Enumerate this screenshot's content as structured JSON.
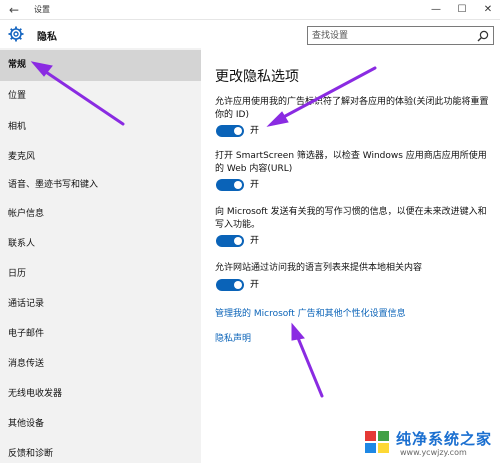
{
  "window": {
    "title": "设置",
    "back_icon": "back-arrow-icon",
    "controls": [
      "minimize-icon",
      "maximize-icon",
      "close-icon"
    ]
  },
  "header": {
    "title": "隐私",
    "icon": "gear-icon"
  },
  "search": {
    "placeholder": "查找设置",
    "icon": "search-icon"
  },
  "sidebar": {
    "items": [
      {
        "label": "常规",
        "active": true
      },
      {
        "label": "位置"
      },
      {
        "label": "相机"
      },
      {
        "label": "麦克风"
      },
      {
        "label": "语音、墨迹书写和键入"
      },
      {
        "label": "帐户信息"
      },
      {
        "label": "联系人"
      },
      {
        "label": "日历"
      },
      {
        "label": "通话记录"
      },
      {
        "label": "电子邮件"
      },
      {
        "label": "消息传送"
      },
      {
        "label": "无线电收发器"
      },
      {
        "label": "其他设备"
      },
      {
        "label": "反馈和诊断"
      }
    ]
  },
  "main": {
    "title": "更改隐私选项",
    "options": [
      {
        "description": "允许应用使用我的广告标识符了解对各应用的体验(关闭此功能将重置你的 ID)",
        "state_label": "开",
        "on": true
      },
      {
        "description": "打开 SmartScreen 筛选器，以检查 Windows 应用商店应用所使用的 Web 内容(URL)",
        "state_label": "开",
        "on": true
      },
      {
        "description": "向 Microsoft 发送有关我的写作习惯的信息，以便在未来改进键入和写入功能。",
        "state_label": "开",
        "on": true
      },
      {
        "description": "允许网站通过访问我的语言列表来提供本地相关内容",
        "state_label": "开",
        "on": true
      }
    ],
    "links": {
      "manage_ads": "管理我的 Microsoft 广告和其他个性化设置信息",
      "privacy_statement": "隐私声明"
    }
  },
  "watermark": {
    "text": "纯净系统之家",
    "url": "www.ycwjzy.com"
  },
  "colors": {
    "accent": "#0a63b8",
    "annotation_arrow": "#8a2be2",
    "sidebar_bg": "#f2f2f2",
    "active_item_bg": "#d4d4d4"
  }
}
